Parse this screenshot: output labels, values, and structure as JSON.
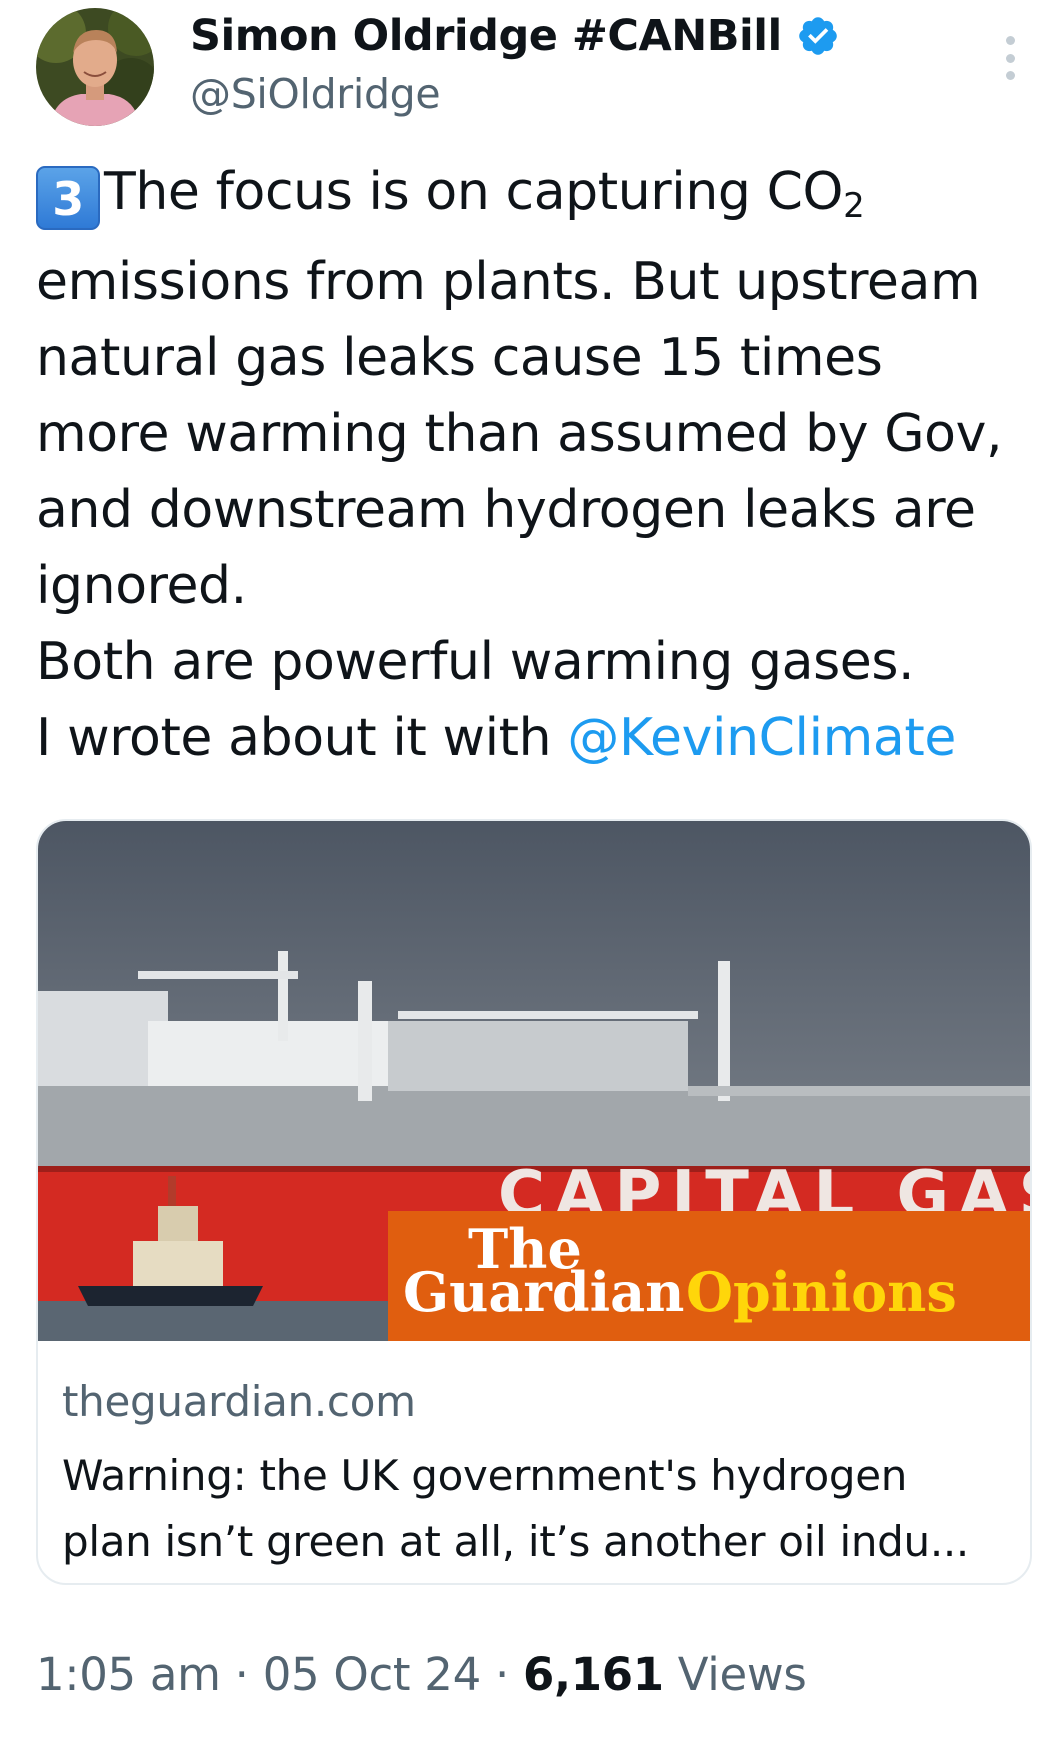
{
  "author": {
    "name": "Simon Oldridge #CANBill",
    "handle": "@SiOldridge"
  },
  "tweet": {
    "keycap": "3",
    "line1_text": "The focus is on capturing CO",
    "line1_sub": "2",
    "line2": "emissions from plants. But upstream",
    "line3": "natural gas leaks cause 15 times",
    "line4": "more warming than assumed by Gov,",
    "line5": "and downstream hydrogen leaks are",
    "line6": "ignored.",
    "line7": "Both are powerful warming gases.",
    "line8_prefix": "I wrote about it with ",
    "mention": "@KevinClimate"
  },
  "card": {
    "image": {
      "hull_text": "CAPITAL GAS",
      "brand_the": "The",
      "brand_guardian": "Guardian",
      "brand_opinions": "Opinions"
    },
    "domain": "theguardian.com",
    "title_line1": "Warning: the UK government's hydrogen",
    "title_line2": "plan isn’t green at all, it’s another oil indu..."
  },
  "meta": {
    "time": "1:05 am",
    "sep1": " · ",
    "date": "05 Oct 24",
    "sep2": " · ",
    "views_count": "6,161",
    "views_label": " Views"
  },
  "colors": {
    "link": "#1d9bf0",
    "secondary": "#536471",
    "verified": "#1d9bf0",
    "hull_red": "#d42a22",
    "guardian_orange": "#e05e0f",
    "opinions_yellow": "#ffd60a"
  },
  "icons": {
    "verified": "verified-badge-icon",
    "more": "more-options-icon"
  }
}
